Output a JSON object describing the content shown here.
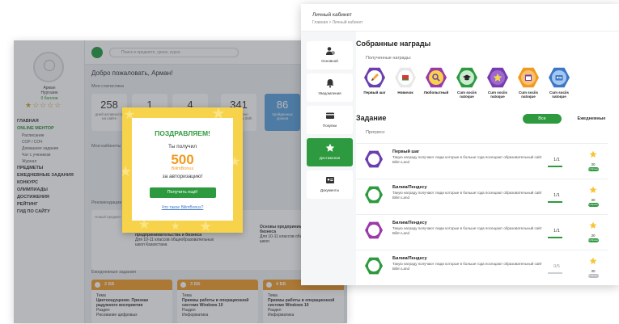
{
  "back": {
    "user": {
      "name": "Арман",
      "surname": "Нургазин",
      "score": "0 баллов",
      "rank": "#1"
    },
    "search_placeholder": "Поиск в предмете, уроке, курсе",
    "greeting": "Добро пожаловать, Арман!",
    "stats_title": "Моя статистика",
    "stats": [
      {
        "value": "258",
        "label": "дней активности на сайте"
      },
      {
        "value": "1",
        "label": "пройдено"
      },
      {
        "value": "4",
        "label": "собрано наград"
      },
      {
        "value": "341",
        "label": "выполнено заданий за 26th"
      },
      {
        "value": "86",
        "label": "пройденных уроков"
      }
    ],
    "menu": [
      {
        "label": "ГЛАВНАЯ",
        "active": false
      },
      {
        "label": "ONLINE МЕНТОР",
        "active": true
      },
      {
        "label": "Расписание",
        "sub": true
      },
      {
        "label": "СОР / СОЧ",
        "sub": true
      },
      {
        "label": "Домашнее задание",
        "sub": true
      },
      {
        "label": "Чат с учеником",
        "sub": true
      },
      {
        "label": "Журнал",
        "sub": true
      },
      {
        "label": "ПРЕДМЕТЫ",
        "active": false
      },
      {
        "label": "ЕЖЕДНЕВНЫЕ ЗАДАНИЯ",
        "active": false
      },
      {
        "label": "КОНКУРС",
        "active": false
      },
      {
        "label": "ОЛИМПИАДЫ",
        "active": false
      },
      {
        "label": "ДОСТИЖЕНИЯ",
        "active": false
      },
      {
        "label": "РЕЙТИНГ",
        "active": false
      },
      {
        "label": "ГИД ПО САЙТУ",
        "active": false
      }
    ],
    "section_courses": "Мои кабинеты",
    "section_recommend": "Рекомендации курсов",
    "course_filter": "Новый предмет",
    "courses": [
      {
        "title": "предпринимательства и бизнеса",
        "desc": "Для 10-11 классов общеобразовательных школ Казахстана"
      },
      {
        "title": "Основы предпринимательства и бизнеса",
        "desc": "Для 10-11 классов общеобразовательных школ"
      }
    ],
    "daily_title": "Ежедневные задания",
    "daily": [
      {
        "points": "2 ББ",
        "type": "Тема",
        "title": "Цветоощущение. Признак радужного восприятия",
        "subject": "Раздел",
        "sub": "Рисование цифровых"
      },
      {
        "points": "3 ББ",
        "type": "Тема",
        "title": "Приемы работы в операционной системе Windows 10",
        "subject": "Раздел",
        "sub": "Информатика"
      },
      {
        "points": "4 ББ",
        "type": "Тема",
        "title": "Приемы работы в операционной системе Windows 10",
        "subject": "Раздел",
        "sub": "Информатика"
      }
    ]
  },
  "congrats": {
    "title": "ПОЗДРАВЛЯЕМ!",
    "received": "Ты получил",
    "amount": "500",
    "currency": "BilimBonus",
    "reason": "за авторизацию!",
    "button": "Получить ещё!",
    "link": "Что такое BilimBonus?"
  },
  "front": {
    "title": "Личный кабинет",
    "breadcrumb": "Главная > Личный кабинет",
    "nav": [
      {
        "label": "Основной",
        "icon": "user-settings-icon"
      },
      {
        "label": "Уведомления",
        "icon": "bell-icon"
      },
      {
        "label": "Покупки",
        "icon": "wallet-icon"
      },
      {
        "label": "Достижения",
        "icon": "star-icon",
        "active": true
      },
      {
        "label": "Документы",
        "icon": "id-card-icon"
      }
    ],
    "awards_heading": "Собранные награды",
    "awards_sub": "Полученные награды:",
    "awards": [
      {
        "label": "Первый шаг",
        "color": "#6a3fb0",
        "icon": "pencil-icon"
      },
      {
        "label": "Новичок",
        "color": "#ffffff",
        "icon": "book-icon"
      },
      {
        "label": "Любопытный",
        "color": "#9b3aa8",
        "icon": "magnifier-icon"
      },
      {
        "label": "Cum sociis natoque",
        "color": "#2e9a3f",
        "icon": "graduation-cap-icon"
      },
      {
        "label": "Cum sociis natoque",
        "color": "#7a3bb0",
        "icon": "star-icon"
      },
      {
        "label": "Cum sociis natoque",
        "color": "#f29a1f",
        "icon": "calendar-icon"
      },
      {
        "label": "Cum sociis natoque",
        "color": "#3b78c8",
        "icon": "id-card-icon"
      }
    ],
    "tasks_heading": "Задание",
    "filters": {
      "all": "Все",
      "daily": "Ежедневные"
    },
    "progress_label": "Прогресс",
    "tasks": [
      {
        "title": "Первый шаг",
        "desc": "Такую награду получают люди которые в больше года посещают образовательный сайт Bilim Land",
        "progress": "1/1",
        "points": "30",
        "badge": "Собрано",
        "color": "#6a3fb0",
        "done": true
      },
      {
        "title": "Билим/Лендесу",
        "desc": "Такую награду получают люди которые в больше года посещают образовательный сайт Bilim Land",
        "progress": "1/1",
        "points": "30",
        "badge": "Собрано",
        "color": "#2e9a3f",
        "done": true
      },
      {
        "title": "Билим/Лендесу",
        "desc": "Такую награду получают люди которые в больше года посещают образовательный сайт Bilim Land",
        "progress": "1/1",
        "points": "30",
        "badge": "Собрано",
        "color": "#9b3aa8",
        "done": true
      },
      {
        "title": "Билим/Лендесу",
        "desc": "Такую награду получают люди которые в больше года посещают образовательный сайт Bilim Land",
        "progress": "0/5",
        "points": "30",
        "badge": "Собрать",
        "color": "#2e9a3f",
        "done": false
      }
    ]
  }
}
